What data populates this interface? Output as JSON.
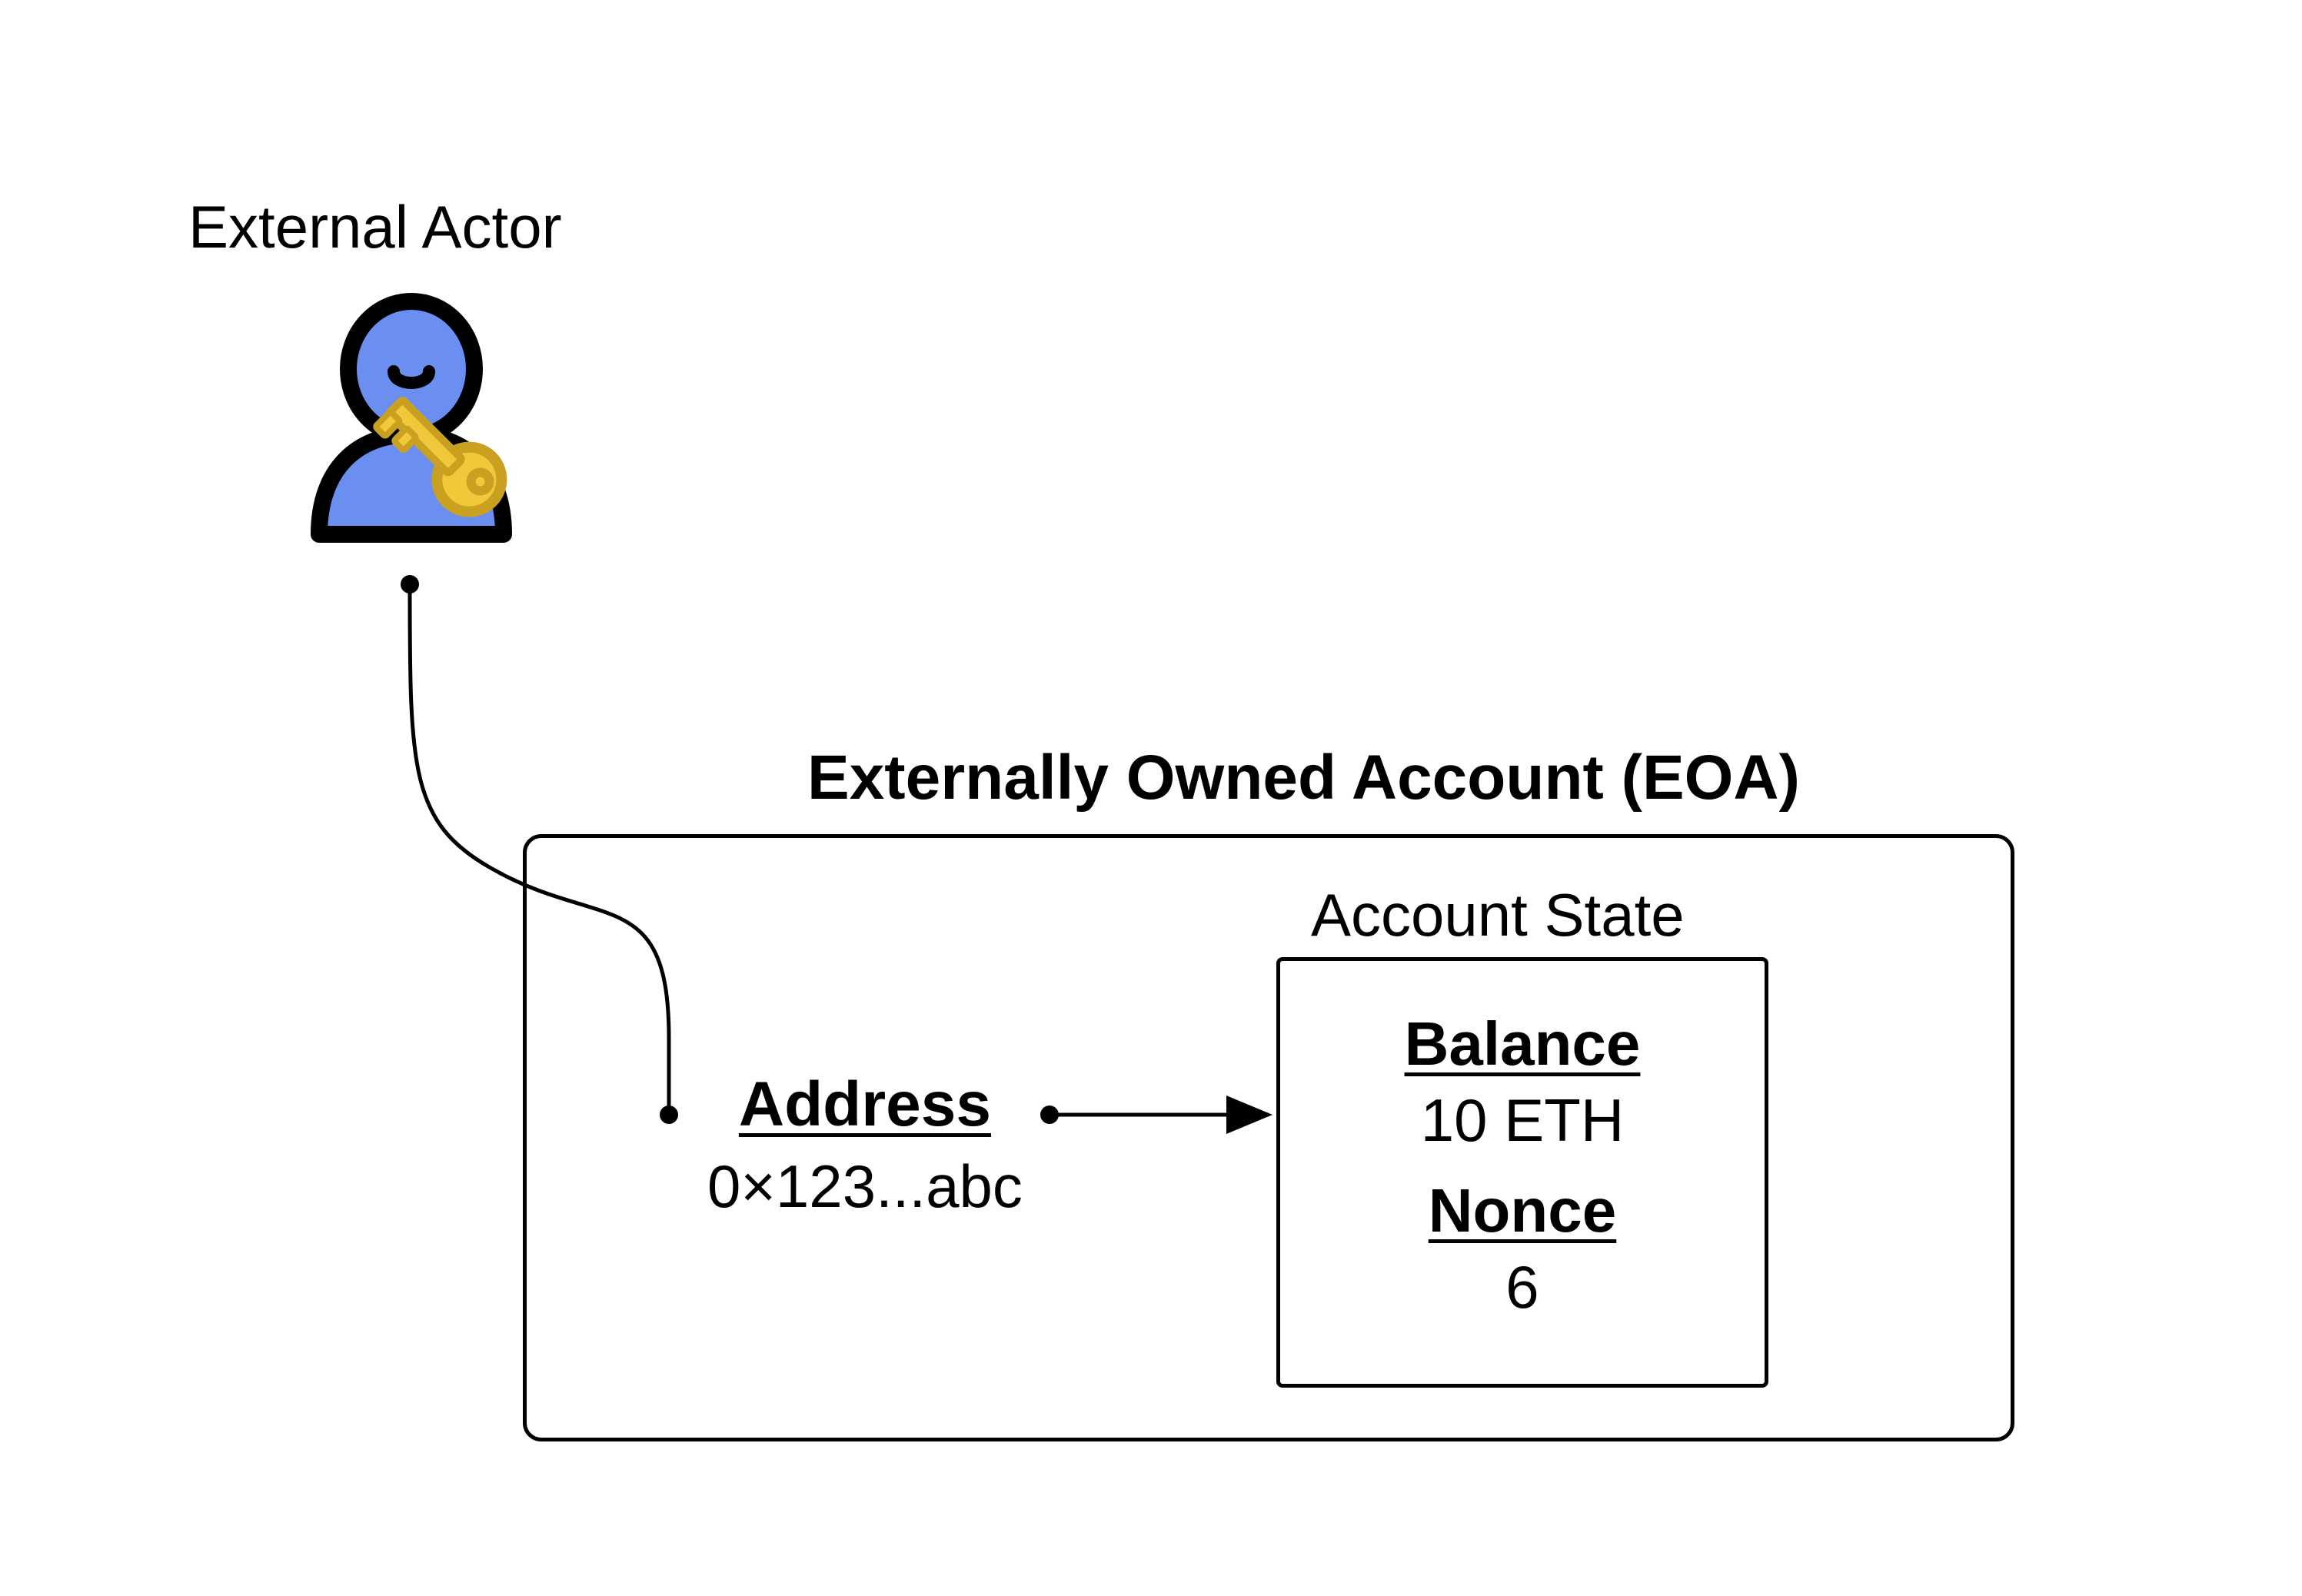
{
  "external_actor_label": "External Actor",
  "eoa_title": "Externally Owned Account (EOA)",
  "address": {
    "label": "Address",
    "value": "0×123...abc"
  },
  "account_state": {
    "title": "Account State",
    "balance": {
      "label": "Balance",
      "value": "10 ETH"
    },
    "nonce": {
      "label": "Nonce",
      "value": "6"
    }
  },
  "icons": {
    "actor": "person-icon",
    "key": "key-icon"
  },
  "colors": {
    "actor_fill": "#6B8FF0",
    "actor_stroke": "#000000",
    "key_fill": "#F0C93A",
    "key_stroke": "#C9A020"
  }
}
